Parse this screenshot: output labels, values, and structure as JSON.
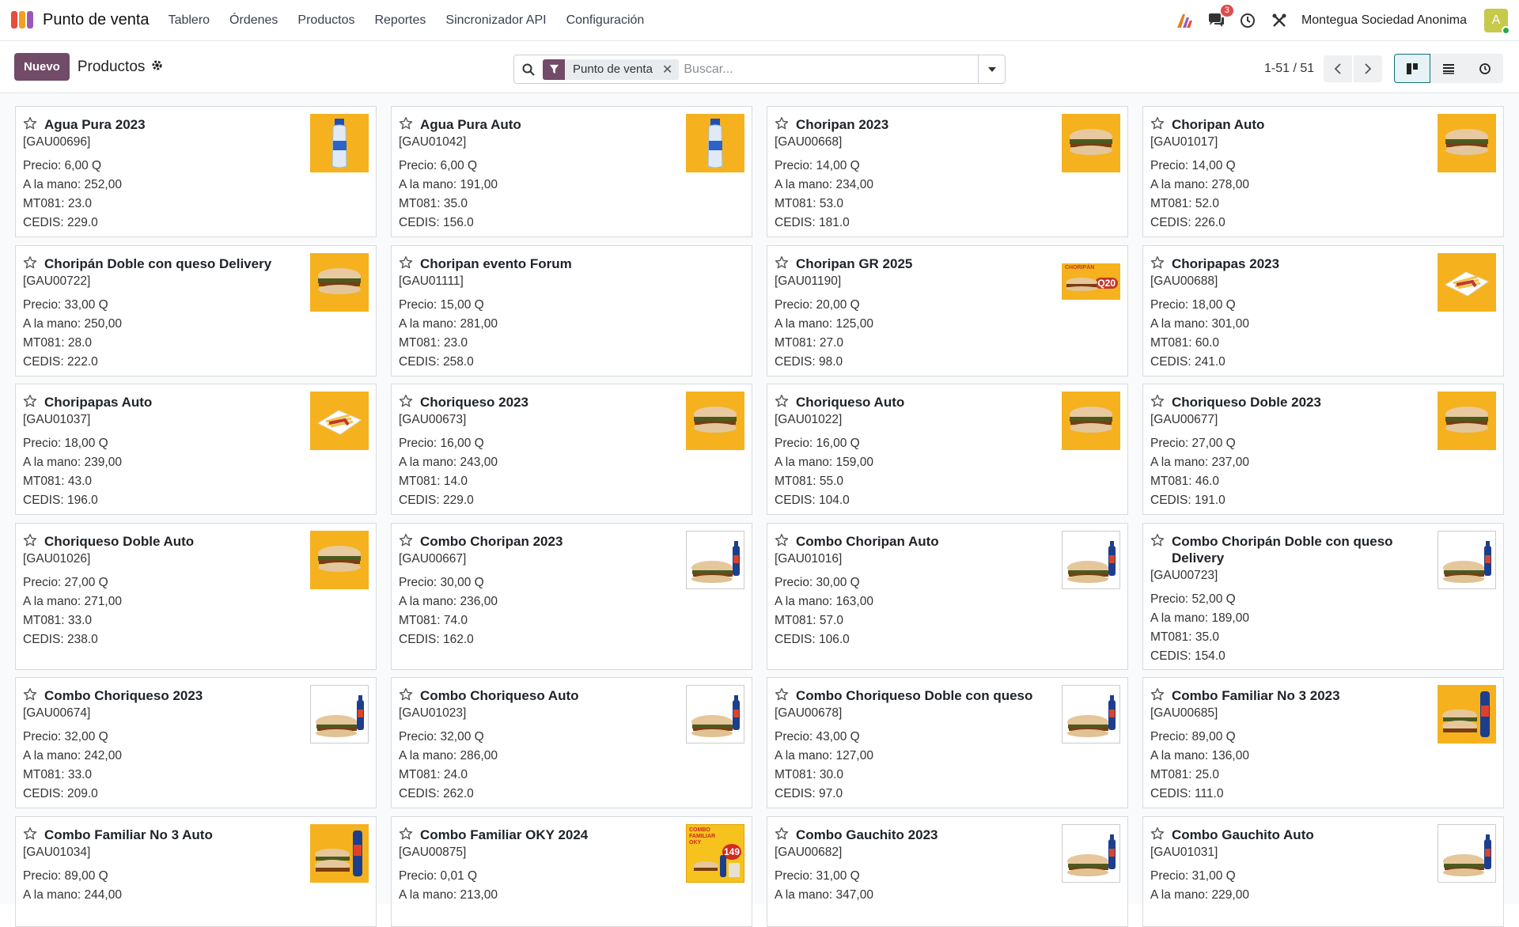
{
  "app": {
    "title": "Punto de venta"
  },
  "menu": [
    "Tablero",
    "Órdenes",
    "Productos",
    "Reportes",
    "Sincronizador API",
    "Configuración"
  ],
  "systray": {
    "messages_count": "3",
    "company": "Montegua Sociedad Anonima",
    "avatar_letter": "A"
  },
  "control": {
    "new_label": "Nuevo",
    "breadcrumb": "Productos"
  },
  "search": {
    "facet": "Punto de venta",
    "placeholder": "Buscar..."
  },
  "pager": {
    "value": "1-51 / 51"
  },
  "colors": {
    "primary": "#714b67",
    "accent": "#0f6f79",
    "thumb_bg": "#f5b21e"
  },
  "products": [
    {
      "name": "Agua Pura 2023",
      "code": "[GAU00696]",
      "precio": "Precio: 6,00 Q",
      "mano": "A la mano: 252,00",
      "mt": "MT081: 23.0",
      "cedis": "CEDIS: 229.0",
      "icon": "water-bottle-image"
    },
    {
      "name": "Agua Pura Auto",
      "code": "[GAU01042]",
      "precio": "Precio: 6,00 Q",
      "mano": "A la mano: 191,00",
      "mt": "MT081: 35.0",
      "cedis": "CEDIS: 156.0",
      "icon": "water-bottle-image"
    },
    {
      "name": "Choripan 2023",
      "code": "[GAU00668]",
      "precio": "Precio: 14,00 Q",
      "mano": "A la mano: 234,00",
      "mt": "MT081: 53.0",
      "cedis": "CEDIS: 181.0",
      "icon": "sandwich-image"
    },
    {
      "name": "Choripan Auto",
      "code": "[GAU01017]",
      "precio": "Precio: 14,00 Q",
      "mano": "A la mano: 278,00",
      "mt": "MT081: 52.0",
      "cedis": "CEDIS: 226.0",
      "icon": "sandwich-image"
    },
    {
      "name": "Choripán Doble con queso Delivery",
      "code": "[GAU00722]",
      "precio": "Precio: 33,00 Q",
      "mano": "A la mano: 250,00",
      "mt": "MT081: 28.0",
      "cedis": "CEDIS: 222.0",
      "icon": "burger-image"
    },
    {
      "name": "Choripan evento Forum",
      "code": "[GAU01111]",
      "precio": "Precio: 15,00 Q",
      "mano": "A la mano: 281,00",
      "mt": "MT081: 23.0",
      "cedis": "CEDIS: 258.0",
      "icon": "none"
    },
    {
      "name": "Choripan GR 2025",
      "code": "[GAU01190]",
      "precio": "Precio: 20,00 Q",
      "mano": "A la mano: 125,00",
      "mt": "MT081: 27.0",
      "cedis": "CEDIS: 98.0",
      "icon": "promo-banner-image",
      "promo_text": "CHORIPÁN",
      "promo_price": "Q20"
    },
    {
      "name": "Choripapas 2023",
      "code": "[GAU00688]",
      "precio": "Precio: 18,00 Q",
      "mano": "A la mano: 301,00",
      "mt": "MT081: 60.0",
      "cedis": "CEDIS: 241.0",
      "icon": "fries-tray-image"
    },
    {
      "name": "Choripapas Auto",
      "code": "[GAU01037]",
      "precio": "Precio: 18,00 Q",
      "mano": "A la mano: 239,00",
      "mt": "MT081: 43.0",
      "cedis": "CEDIS: 196.0",
      "icon": "fries-tray-image"
    },
    {
      "name": "Choriqueso 2023",
      "code": "[GAU00673]",
      "precio": "Precio: 16,00 Q",
      "mano": "A la mano: 243,00",
      "mt": "MT081: 14.0",
      "cedis": "CEDIS: 229.0",
      "icon": "burger-image"
    },
    {
      "name": "Choriqueso Auto",
      "code": "[GAU01022]",
      "precio": "Precio: 16,00 Q",
      "mano": "A la mano: 159,00",
      "mt": "MT081: 55.0",
      "cedis": "CEDIS: 104.0",
      "icon": "burger-image"
    },
    {
      "name": "Choriqueso Doble 2023",
      "code": "[GAU00677]",
      "precio": "Precio: 27,00 Q",
      "mano": "A la mano: 237,00",
      "mt": "MT081: 46.0",
      "cedis": "CEDIS: 191.0",
      "icon": "burger-image"
    },
    {
      "name": "Choriqueso Doble Auto",
      "code": "[GAU01026]",
      "precio": "Precio: 27,00 Q",
      "mano": "A la mano: 271,00",
      "mt": "MT081: 33.0",
      "cedis": "CEDIS: 238.0",
      "icon": "burger-image"
    },
    {
      "name": "Combo Choripan 2023",
      "code": "[GAU00667]",
      "precio": "Precio: 30,00 Q",
      "mano": "A la mano: 236,00",
      "mt": "MT081: 74.0",
      "cedis": "CEDIS: 162.0",
      "icon": "combo-white-image"
    },
    {
      "name": "Combo Choripan Auto",
      "code": "[GAU01016]",
      "precio": "Precio: 30,00 Q",
      "mano": "A la mano: 163,00",
      "mt": "MT081: 57.0",
      "cedis": "CEDIS: 106.0",
      "icon": "combo-white-image"
    },
    {
      "name": "Combo Choripán Doble con queso Delivery",
      "code": "[GAU00723]",
      "precio": "Precio: 52,00 Q",
      "mano": "A la mano: 189,00",
      "mt": "MT081: 35.0",
      "cedis": "CEDIS: 154.0",
      "icon": "combo-white-image"
    },
    {
      "name": "Combo Choriqueso 2023",
      "code": "[GAU00674]",
      "precio": "Precio: 32,00 Q",
      "mano": "A la mano: 242,00",
      "mt": "MT081: 33.0",
      "cedis": "CEDIS: 209.0",
      "icon": "combo-white-image"
    },
    {
      "name": "Combo Choriqueso Auto",
      "code": "[GAU01023]",
      "precio": "Precio: 32,00 Q",
      "mano": "A la mano: 286,00",
      "mt": "MT081: 24.0",
      "cedis": "CEDIS: 262.0",
      "icon": "combo-white-image"
    },
    {
      "name": "Combo Choriqueso Doble con queso",
      "code": "[GAU00678]",
      "precio": "Precio: 43,00 Q",
      "mano": "A la mano: 127,00",
      "mt": "MT081: 30.0",
      "cedis": "CEDIS: 97.0",
      "icon": "combo-white-image"
    },
    {
      "name": "Combo Familiar No 3 2023",
      "code": "[GAU00685]",
      "precio": "Precio: 89,00 Q",
      "mano": "A la mano: 136,00",
      "mt": "MT081: 25.0",
      "cedis": "CEDIS: 111.0",
      "icon": "family-combo-image"
    },
    {
      "name": "Combo Familiar No 3 Auto",
      "code": "[GAU01034]",
      "precio": "Precio: 89,00 Q",
      "mano": "A la mano: 244,00",
      "mt": "",
      "cedis": "",
      "icon": "family-combo-image"
    },
    {
      "name": "Combo Familiar OKY 2024",
      "code": "[GAU00875]",
      "precio": "Precio: 0,01 Q",
      "mano": "A la mano: 213,00",
      "mt": "",
      "cedis": "",
      "icon": "oky-promo-image",
      "promo_text": "COMBO FAMILIAR OKY",
      "promo_price": "149"
    },
    {
      "name": "Combo Gauchito 2023",
      "code": "[GAU00682]",
      "precio": "Precio: 31,00 Q",
      "mano": "A la mano: 347,00",
      "mt": "",
      "cedis": "",
      "icon": "combo-white-image"
    },
    {
      "name": "Combo Gauchito Auto",
      "code": "[GAU01031]",
      "precio": "Precio: 31,00 Q",
      "mano": "A la mano: 229,00",
      "mt": "",
      "cedis": "",
      "icon": "combo-white-image"
    }
  ]
}
